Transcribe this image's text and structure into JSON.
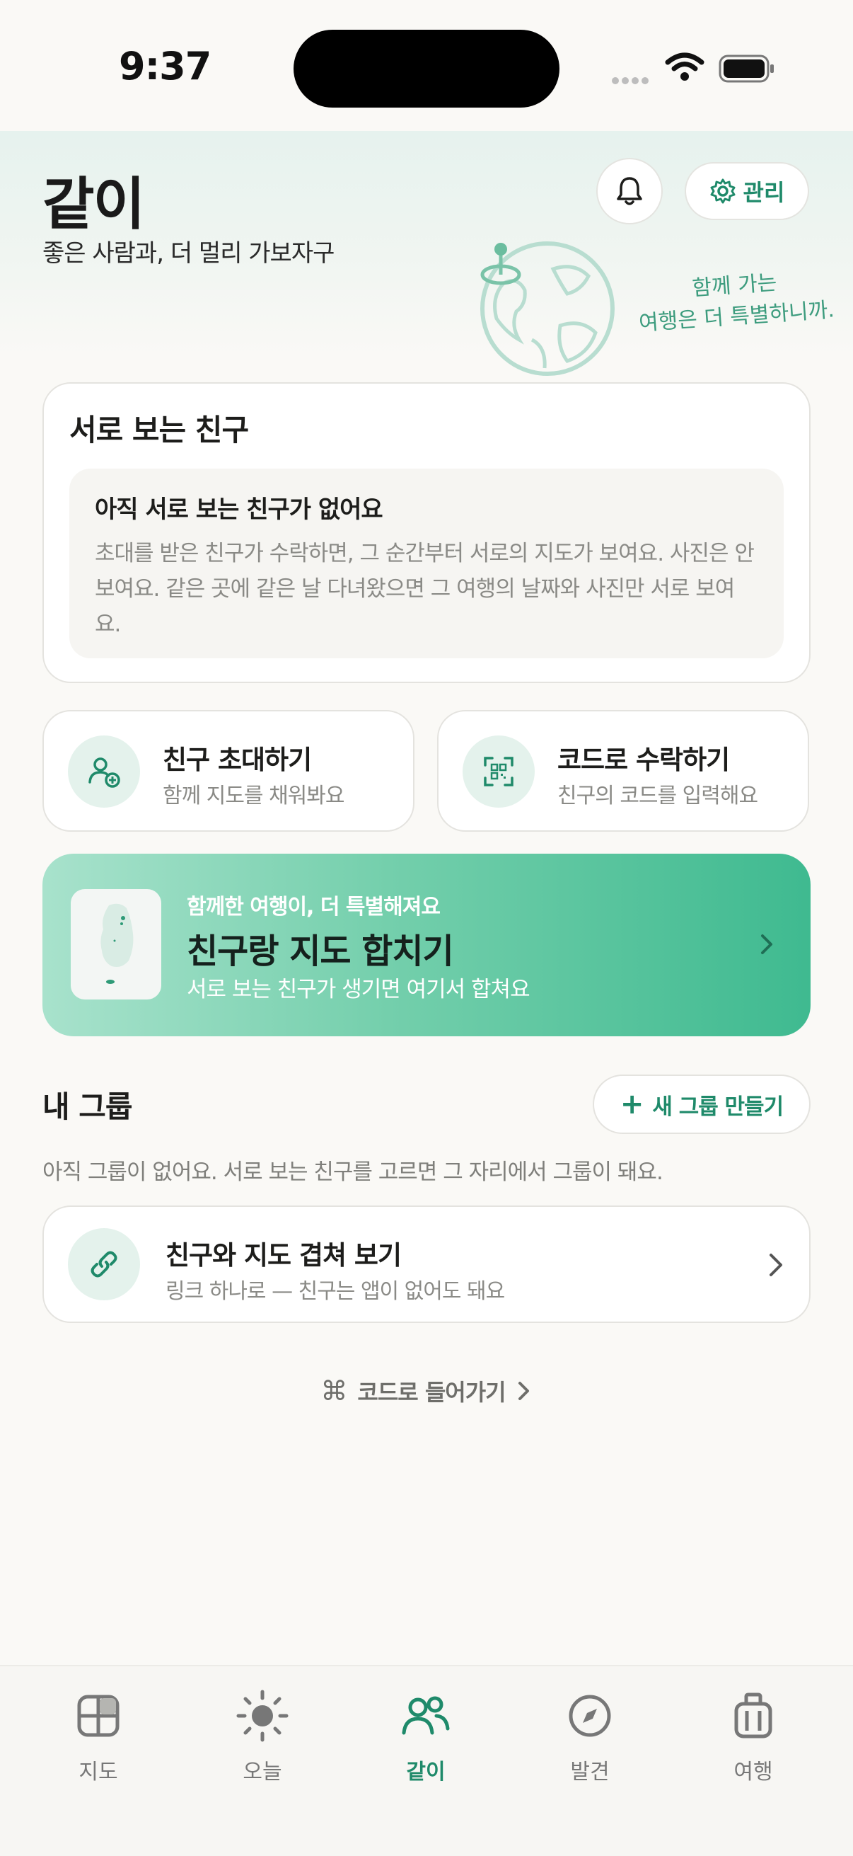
{
  "status": {
    "time": "9:37"
  },
  "header": {
    "title": "같이",
    "subtitle": "좋은 사람과, 더 멀리 가보자구",
    "manage_label": "관리",
    "tagline_line1": "함께 가는",
    "tagline_line2": "여행은 더 특별하니까."
  },
  "friends": {
    "title": "서로 보는 친구",
    "empty_title": "아직 서로 보는 친구가 없어요",
    "empty_desc": "초대를 받은 친구가 수락하면, 그 순간부터 서로의 지도가 보여요. 사진은 안 보여요. 같은 곳에 같은 날 다녀왔으면 그 여행의 날짜와 사진만 서로 보여요."
  },
  "actions": {
    "invite_title": "친구 초대하기",
    "invite_sub": "함께 지도를 채워봐요",
    "code_title": "코드로 수락하기",
    "code_sub": "친구의 코드를 입력해요"
  },
  "merge": {
    "kicker": "함께한 여행이, 더 특별해져요",
    "title": "친구랑 지도 합치기",
    "sub": "서로 보는 친구가 생기면 여기서 합쳐요"
  },
  "groups": {
    "title": "내 그룹",
    "new_group_label": "새 그룹 만들기",
    "empty_text": "아직 그룹이 없어요. 서로 보는 친구를 고르면 그 자리에서 그룹이 돼요."
  },
  "link": {
    "title": "친구와 지도 겹쳐 보기",
    "sub": "링크 하나로 — 친구는 앱이 없어도 돼요"
  },
  "code_enter": {
    "icon": "⌘",
    "label": "코드로 들어가기"
  },
  "tabs": [
    {
      "label": "지도",
      "icon": "map-icon"
    },
    {
      "label": "오늘",
      "icon": "sun-icon"
    },
    {
      "label": "같이",
      "icon": "people-icon",
      "active": true
    },
    {
      "label": "발견",
      "icon": "compass-icon"
    },
    {
      "label": "여행",
      "icon": "luggage-icon"
    }
  ],
  "colors": {
    "accent": "#1f8a6a",
    "banner_start": "#a8e2cc",
    "banner_end": "#3fba90"
  }
}
